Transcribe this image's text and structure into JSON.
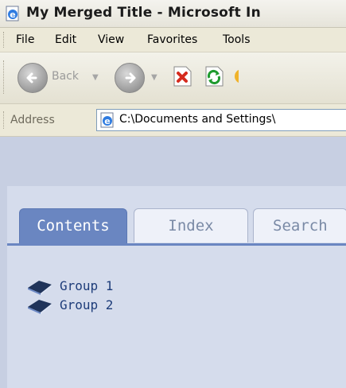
{
  "window": {
    "title": "My Merged Title - Microsoft In"
  },
  "menu": {
    "items": [
      "File",
      "Edit",
      "View",
      "Favorites",
      "Tools"
    ]
  },
  "toolbar": {
    "back_label": "Back"
  },
  "address": {
    "label": "Address",
    "value": "C:\\Documents and Settings\\"
  },
  "help": {
    "tabs": [
      "Contents",
      "Index",
      "Search"
    ],
    "active_tab": "Contents",
    "tree": [
      {
        "label": "Group 1"
      },
      {
        "label": "Group 2"
      }
    ]
  },
  "colors": {
    "active_tab": "#6a86c1",
    "pane_bg": "#d5dcec",
    "tree_text": "#1e3d7a"
  }
}
